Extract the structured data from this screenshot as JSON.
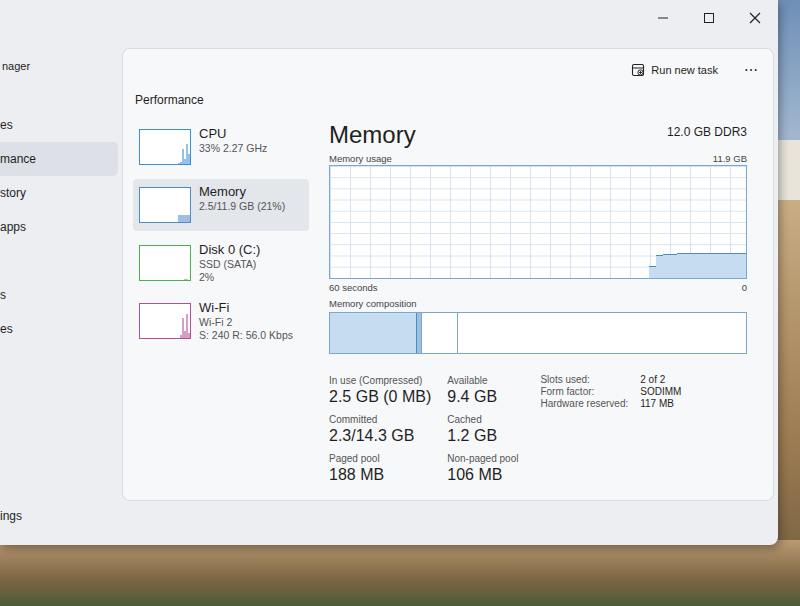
{
  "window": {
    "title": "nager"
  },
  "sidebar": {
    "items": [
      {
        "label": "es",
        "selected": false
      },
      {
        "label": "mance",
        "selected": true
      },
      {
        "label": "story",
        "selected": false
      },
      {
        "label": "apps",
        "selected": false
      },
      {
        "label": "s",
        "selected": false
      },
      {
        "label": "es",
        "selected": false
      },
      {
        "label": "ings",
        "selected": false
      }
    ]
  },
  "performance": {
    "title": "Performance"
  },
  "toolbar": {
    "run_task": "Run new task",
    "more": "⋯"
  },
  "devices": [
    {
      "name": "CPU",
      "lines": [
        "33% 2.27 GHz"
      ],
      "selected": false,
      "color": "#3b8fd9",
      "values": [
        0,
        0,
        0,
        0,
        0,
        0,
        0,
        0,
        0,
        0,
        0,
        0,
        0,
        0,
        0,
        0,
        0,
        0,
        0,
        2,
        5,
        45,
        15,
        60,
        30
      ]
    },
    {
      "name": "Memory",
      "lines": [
        "2.5/11.9 GB (21%)"
      ],
      "selected": true,
      "color": "#4f8ac4",
      "values": [
        0,
        0,
        0,
        0,
        0,
        0,
        0,
        0,
        0,
        0,
        0,
        0,
        0,
        0,
        0,
        0,
        0,
        0,
        0,
        21,
        21,
        21,
        21,
        21,
        21
      ]
    },
    {
      "name": "Disk 0 (C:)",
      "lines": [
        "SSD (SATA)",
        "2%"
      ],
      "selected": false,
      "color": "#4caf50",
      "values": [
        0,
        0,
        0,
        0,
        0,
        0,
        0,
        0,
        0,
        0,
        0,
        0,
        0,
        0,
        0,
        0,
        0,
        0,
        0,
        0,
        0,
        0,
        3,
        2,
        1
      ]
    },
    {
      "name": "Wi-Fi",
      "lines": [
        "Wi-Fi 2",
        "S: 240 R: 56.0 Kbps"
      ],
      "selected": false,
      "color": "#b0509a",
      "values": [
        0,
        0,
        0,
        0,
        0,
        0,
        0,
        0,
        0,
        0,
        0,
        0,
        0,
        0,
        0,
        0,
        0,
        0,
        0,
        0,
        10,
        60,
        20,
        70,
        15
      ]
    }
  ],
  "detail": {
    "title": "Memory",
    "spec": "12.0 GB DDR3",
    "usage_label": "Memory usage",
    "max_label": "11.9 GB",
    "max_value": 11.9,
    "usage_values": [
      1.2,
      2.3,
      2.4,
      2.4,
      2.5,
      2.5,
      2.5,
      2.5,
      2.5,
      2.5,
      2.5,
      2.5,
      2.5,
      2.5
    ],
    "axis_left": "60 seconds",
    "axis_right": "0",
    "composition_label": "Memory composition",
    "composition": [
      {
        "kind": "in-use",
        "level": 0.21
      },
      {
        "kind": "modified",
        "level": 0.008
      },
      {
        "kind": "standby",
        "level": 0.09
      },
      {
        "kind": "free",
        "level": 0.692
      }
    ],
    "stats": [
      {
        "label": "In use (Compressed)",
        "value": "2.5 GB (0 MB)"
      },
      {
        "label": "Available",
        "value": "9.4 GB"
      },
      {
        "label": "Committed",
        "value": "2.3/14.3 GB"
      },
      {
        "label": "Cached",
        "value": "1.2 GB"
      },
      {
        "label": "Paged pool",
        "value": "188 MB"
      },
      {
        "label": "Non-paged pool",
        "value": "106 MB"
      }
    ],
    "properties": [
      {
        "key": "Slots used:",
        "value": "2 of 2"
      },
      {
        "key": "Form factor:",
        "value": "SODIMM"
      },
      {
        "key": "Hardware reserved:",
        "value": "117 MB"
      }
    ]
  }
}
